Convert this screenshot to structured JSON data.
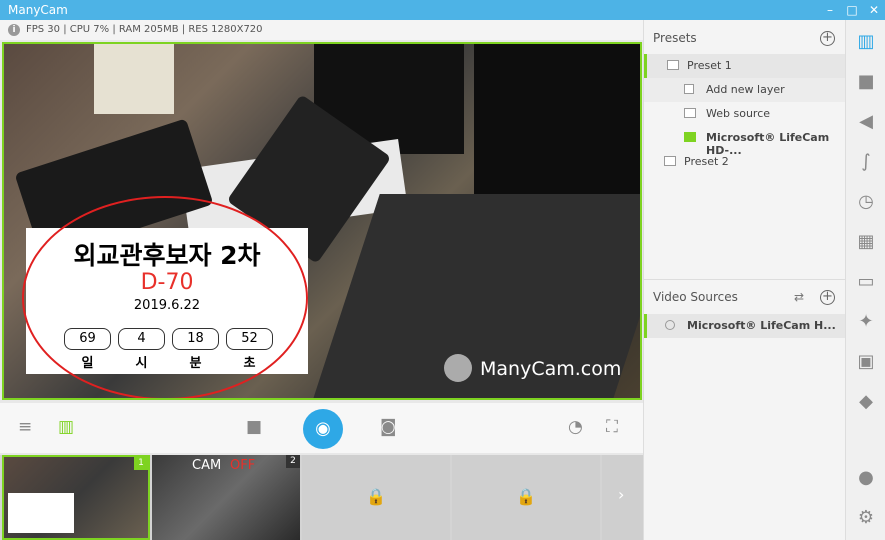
{
  "app": {
    "title": "ManyCam"
  },
  "window_controls": {
    "minimize": "–",
    "maximize": "□",
    "close": "✕"
  },
  "status": {
    "stats": "FPS 30 | CPU 7% | RAM 205MB | RES 1280X720"
  },
  "preview": {
    "watermark": "ManyCam.com",
    "overlay": {
      "title": "외교관후보자 2차",
      "dday": "D-70",
      "date": "2019.6.22",
      "countdown": [
        {
          "value": "69",
          "unit": "일"
        },
        {
          "value": "4",
          "unit": "시"
        },
        {
          "value": "18",
          "unit": "분"
        },
        {
          "value": "52",
          "unit": "초"
        }
      ]
    }
  },
  "thumbnails": [
    {
      "num": "1"
    },
    {
      "num": "2",
      "label_cam": "CAM",
      "label_off": "OFF"
    },
    {
      "locked": true
    },
    {
      "locked": true
    }
  ],
  "presets": {
    "header": "Presets",
    "items": [
      {
        "label": "Preset 1",
        "active": true
      },
      {
        "label": "Add new layer"
      },
      {
        "label": "Web source"
      },
      {
        "label": "Microsoft® LifeCam HD-..."
      },
      {
        "label": "Preset 2"
      }
    ]
  },
  "video_sources": {
    "header": "Video Sources",
    "items": [
      {
        "label": "Microsoft® LifeCam H..."
      }
    ]
  },
  "colors": {
    "accent": "#4db3e6",
    "active_green": "#7ed321",
    "broadcast": "#2ea8e6",
    "dday_red": "#e8302a"
  }
}
